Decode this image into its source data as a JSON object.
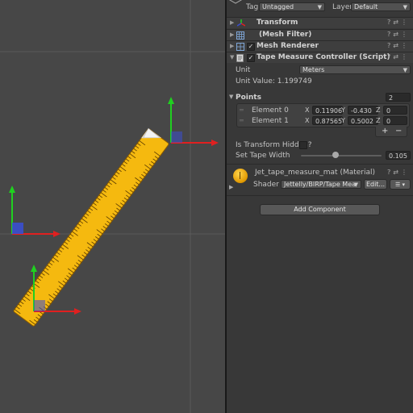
{
  "header": {
    "tag_label": "Tag",
    "tag_value": "Untagged",
    "layer_label": "Layer",
    "layer_value": "Default"
  },
  "components": {
    "transform": "Transform",
    "mesh_filter": "(Mesh Filter)",
    "mesh_renderer": "Mesh Renderer",
    "script": "Tape Measure Controller (Script)"
  },
  "script": {
    "unit_label": "Unit",
    "unit_value": "Meters",
    "unit_value_text": "Unit Value: 1.199749",
    "points_label": "Points",
    "points_count": "2",
    "elements": [
      {
        "label": "Element 0",
        "x_label": "X",
        "x": "0.11906",
        "y_label": "Y",
        "y": "-0.430",
        "z_label": "Z",
        "z": "0"
      },
      {
        "label": "Element 1",
        "x_label": "X",
        "x": "0.87565",
        "y_label": "Y",
        "y": "0.5002",
        "z_label": "Z",
        "z": "0"
      }
    ],
    "add_symbol": "+",
    "remove_symbol": "−",
    "hidden_label": "Is Transform Hidden?",
    "hidden_checked": false,
    "width_label": "Set Tape Width",
    "width_value": "0.105",
    "width_fraction": 0.43
  },
  "material": {
    "name": "Jet_tape_measure_mat (Material)",
    "shader_label": "Shader",
    "shader_value": "Jettelly/BIRP/Tape Mea",
    "edit_label": "Edit..."
  },
  "add_component_label": "Add Component",
  "colors": {
    "x_axis": "#e02020",
    "y_axis": "#20d020",
    "z_axis": "#3a4fd0",
    "tape": "#f5b90f",
    "scene_bg": "#474747",
    "inspector_bg": "#383838"
  }
}
